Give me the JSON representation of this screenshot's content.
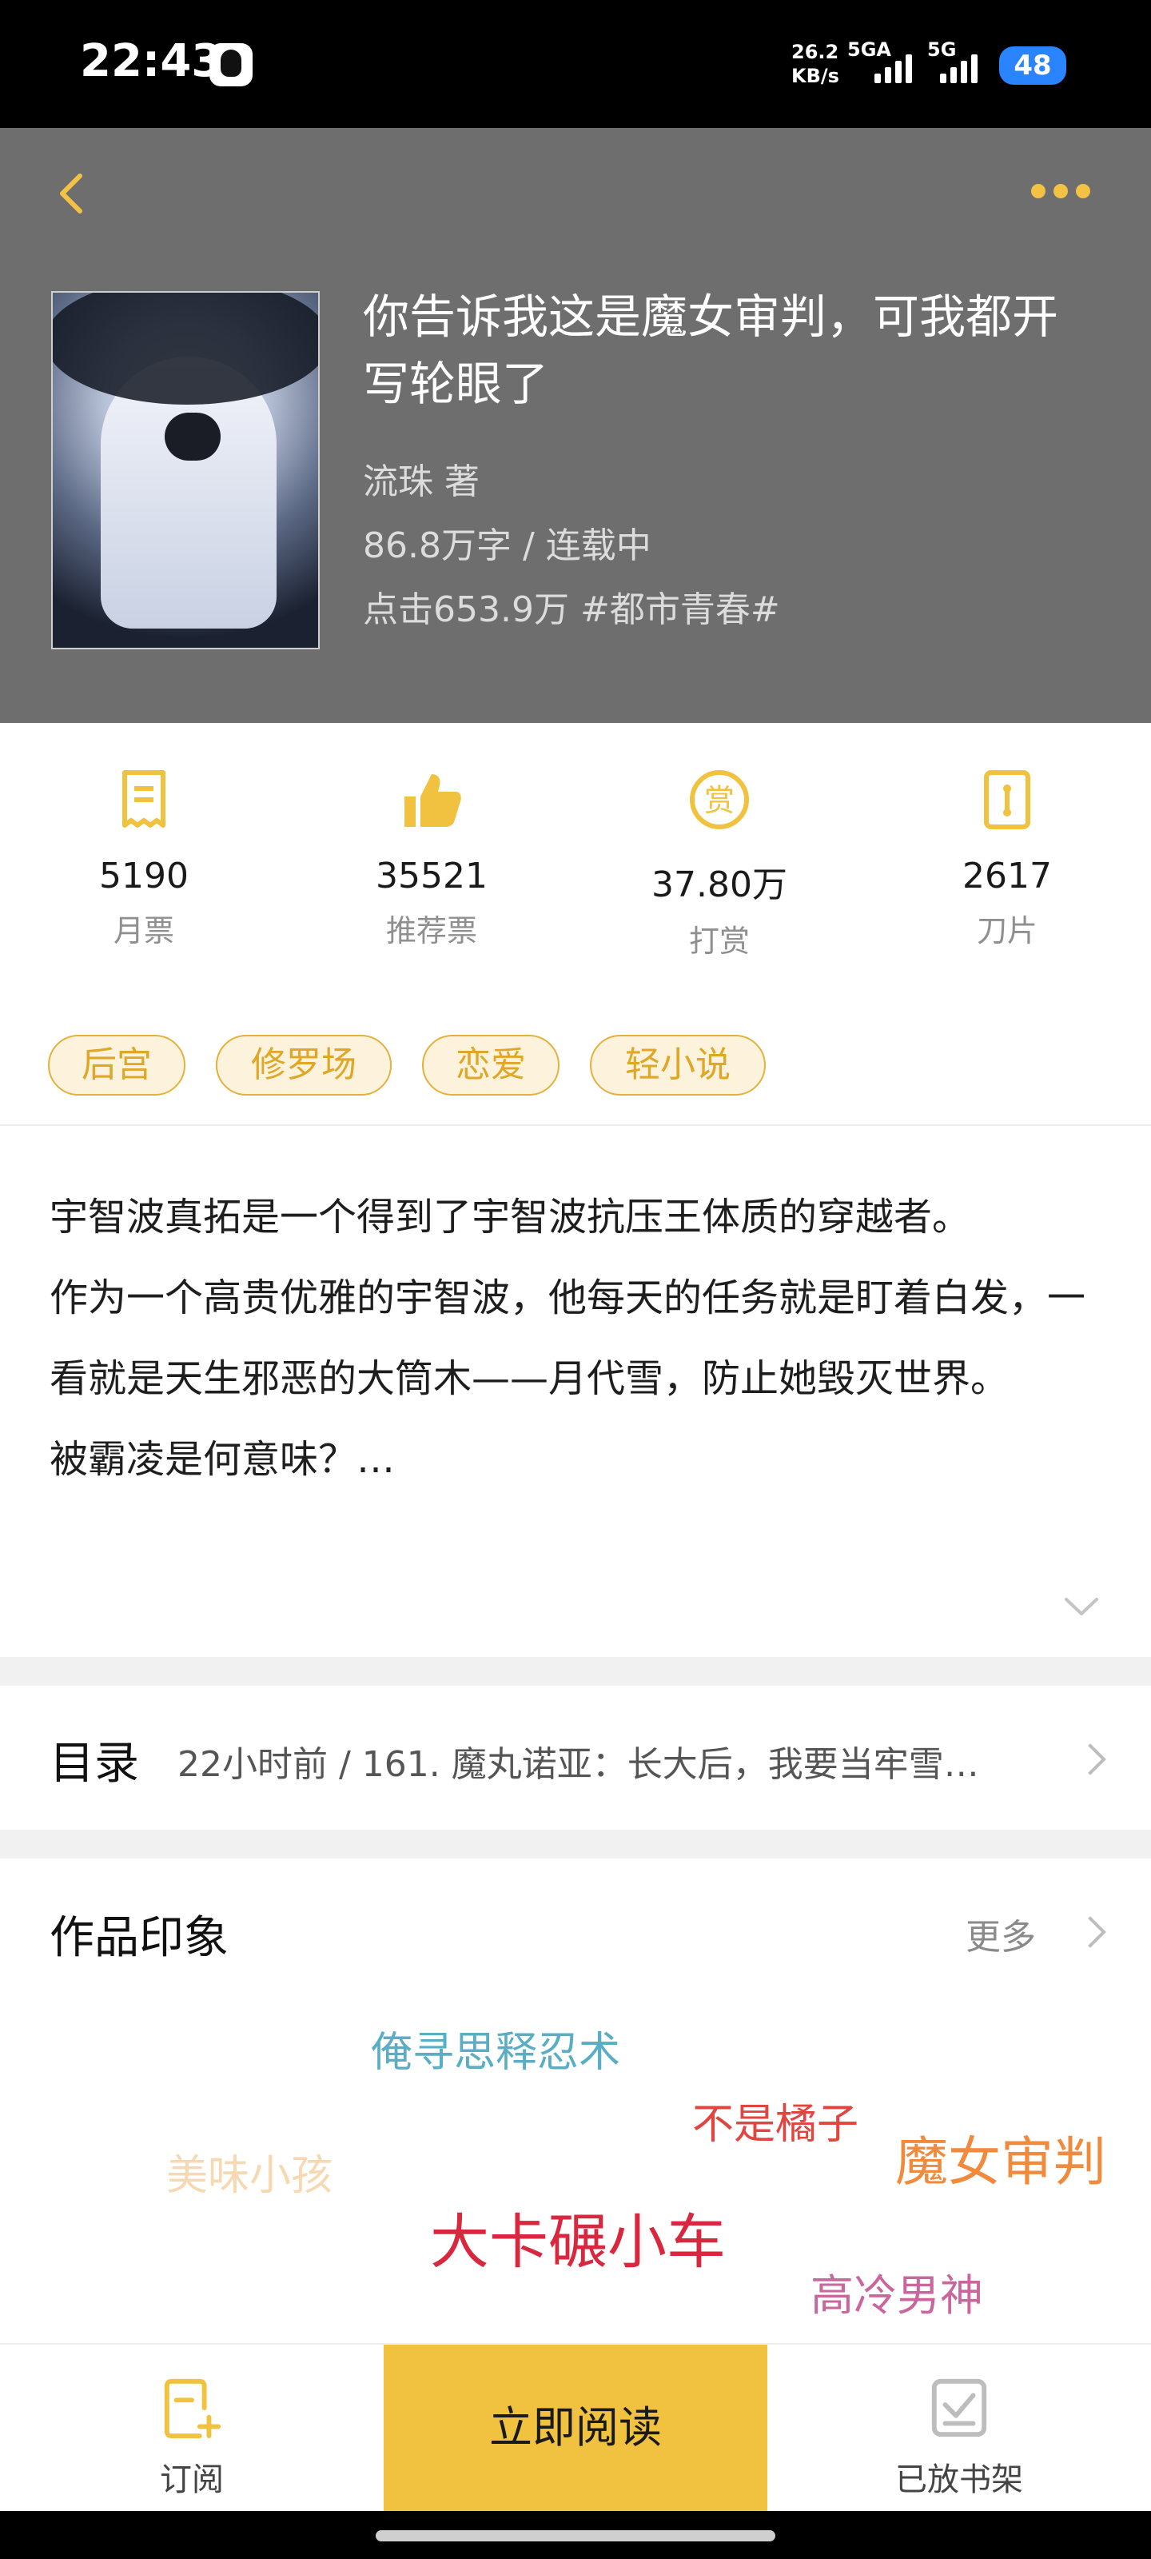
{
  "status_bar": {
    "time": "22:43",
    "speed_value": "26.2",
    "speed_unit": "KB/s",
    "network_1": "5GA",
    "network_2": "5G",
    "battery": "48"
  },
  "book": {
    "title": "你告诉我这是魔女审判，可我都开写轮眼了",
    "author_line": "流珠  著",
    "words_status": "86.8万字 / 连载中",
    "clicks_genre": "点击653.9万  #都市青春#"
  },
  "stats": [
    {
      "icon": "monthly-ticket-icon",
      "value": "5190",
      "label": "月票"
    },
    {
      "icon": "thumbs-up-icon",
      "value": "35521",
      "label": "推荐票"
    },
    {
      "icon": "reward-coin-icon",
      "value": "37.80万",
      "label": "打赏"
    },
    {
      "icon": "blade-card-icon",
      "value": "2617",
      "label": "刀片"
    }
  ],
  "tags": [
    "后宫",
    "修罗场",
    "恋爱",
    "轻小说"
  ],
  "description": {
    "line1": "宇智波真拓是一个得到了宇智波抗压王体质的穿越者。",
    "line2": "作为一个高贵优雅的宇智波，他每天的任务就是盯着白发，一看就是天生邪恶的大筒木——月代雪，防止她毁灭世界。",
    "line3": "被霸凌是何意味？…"
  },
  "toc": {
    "title": "目录",
    "latest": "22小时前 / 161. 魔丸诺亚：长大后，我要当牢雪…"
  },
  "impressions": {
    "title": "作品印象",
    "more": "更多",
    "words": [
      {
        "text": "俺寻思释忍术",
        "color": "#5aaec4"
      },
      {
        "text": "不是橘子",
        "color": "#e0453f"
      },
      {
        "text": "魔女审判",
        "color": "#f08a3c"
      },
      {
        "text": "美味小孩",
        "color": "#f6d9b2"
      },
      {
        "text": "大卡碾小车",
        "color": "#d8283f"
      },
      {
        "text": "高冷男神",
        "color": "#c9679c"
      }
    ]
  },
  "bottom_bar": {
    "subscribe": "订阅",
    "read_now": "立即阅读",
    "on_shelf": "已放书架"
  },
  "colors": {
    "accent": "#f0c23f",
    "header_bg": "#6e6e6e",
    "tag_text": "#e0a626"
  }
}
